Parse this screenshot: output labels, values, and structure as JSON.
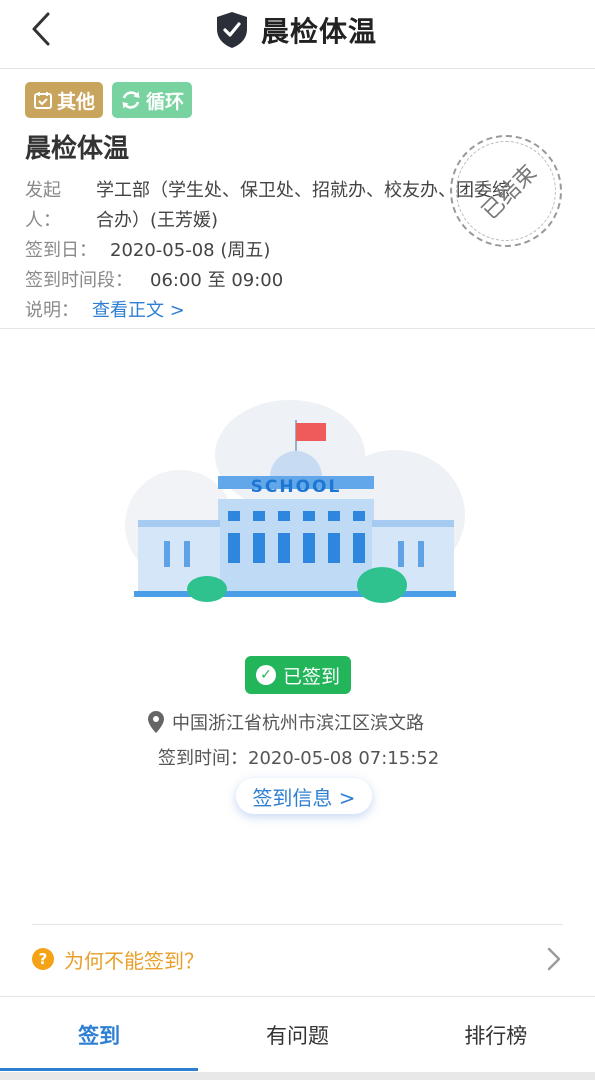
{
  "header": {
    "title": "晨检体温"
  },
  "info": {
    "tags": {
      "other": "其他",
      "cycle": "循环"
    },
    "title": "晨检体温",
    "initiator_label_1": "发起",
    "initiator_label_2": "人：",
    "initiator_value_1": "学工部（学生处、保卫处、招就办、校友办、团委综",
    "initiator_value_2": "合办）(王芳媛)",
    "date_label": "签到日：",
    "date_value": "2020-05-08 (周五)",
    "period_label": "签到时间段：",
    "period_value": "06:00 至 09:00",
    "desc_label": "说明：",
    "desc_link": "查看正文 >",
    "stamp": "已结束"
  },
  "illustration": {
    "school_text": "SCHOOL"
  },
  "status": {
    "badge": "已签到",
    "location": "中国浙江省杭州市滨江区滨文路",
    "time": "签到时间：2020-05-08 07:15:52",
    "info_button": "签到信息 >"
  },
  "help": {
    "text": "为何不能签到？"
  },
  "tabs": [
    {
      "label": "签到"
    },
    {
      "label": "有问题"
    },
    {
      "label": "排行榜"
    }
  ],
  "colors": {
    "accent": "#2e7fd1",
    "success": "#22b55a",
    "warning": "#f5a316",
    "tag_other": "#c9a45c",
    "tag_cycle": "#79d3a0"
  }
}
